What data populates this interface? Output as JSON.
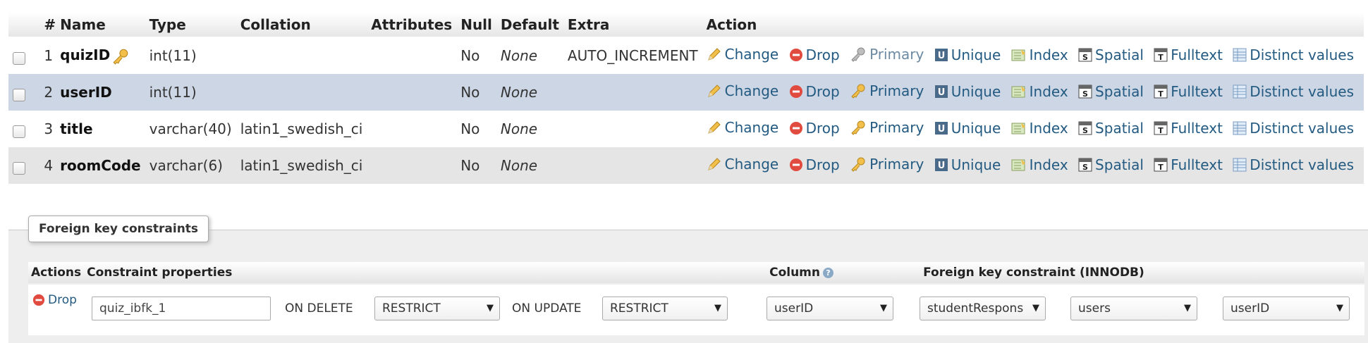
{
  "structure": {
    "headers": [
      "#",
      "Name",
      "Type",
      "Collation",
      "Attributes",
      "Null",
      "Default",
      "Extra",
      "Action"
    ],
    "rows": [
      {
        "num": "1",
        "name": "quizID",
        "type": "int(11)",
        "collation": "",
        "attributes": "",
        "null": "No",
        "default": "None",
        "extra": "AUTO_INCREMENT",
        "primary_key": true
      },
      {
        "num": "2",
        "name": "userID",
        "type": "int(11)",
        "collation": "",
        "attributes": "",
        "null": "No",
        "default": "None",
        "extra": "",
        "primary_key": false
      },
      {
        "num": "3",
        "name": "title",
        "type": "varchar(40)",
        "collation": "latin1_swedish_ci",
        "attributes": "",
        "null": "No",
        "default": "None",
        "extra": "",
        "primary_key": false
      },
      {
        "num": "4",
        "name": "roomCode",
        "type": "varchar(6)",
        "collation": "latin1_swedish_ci",
        "attributes": "",
        "null": "No",
        "default": "None",
        "extra": "",
        "primary_key": false
      }
    ],
    "actions": {
      "change": "Change",
      "drop": "Drop",
      "primary": "Primary",
      "unique": "Unique",
      "index": "Index",
      "spatial": "Spatial",
      "fulltext": "Fulltext",
      "distinct": "Distinct values"
    }
  },
  "foreign_keys": {
    "legend": "Foreign key constraints",
    "headers": {
      "actions": "Actions",
      "properties": "Constraint properties",
      "column": "Column",
      "fk_constraint": "Foreign key constraint (INNODB)"
    },
    "row": {
      "drop_label": "Drop",
      "constraint_name": "quiz_ibfk_1",
      "on_delete_label": "ON DELETE",
      "on_delete_value": "RESTRICT",
      "on_update_label": "ON UPDATE",
      "on_update_value": "RESTRICT",
      "column_value": "userID",
      "ref_database": "studentRespons",
      "ref_table": "users",
      "ref_column": "userID"
    }
  },
  "colors": {
    "link": "#235a81",
    "highlight_row": "#ccd6e4",
    "alt_row": "#e5e5e5",
    "drop_red": "#e04a3f"
  }
}
